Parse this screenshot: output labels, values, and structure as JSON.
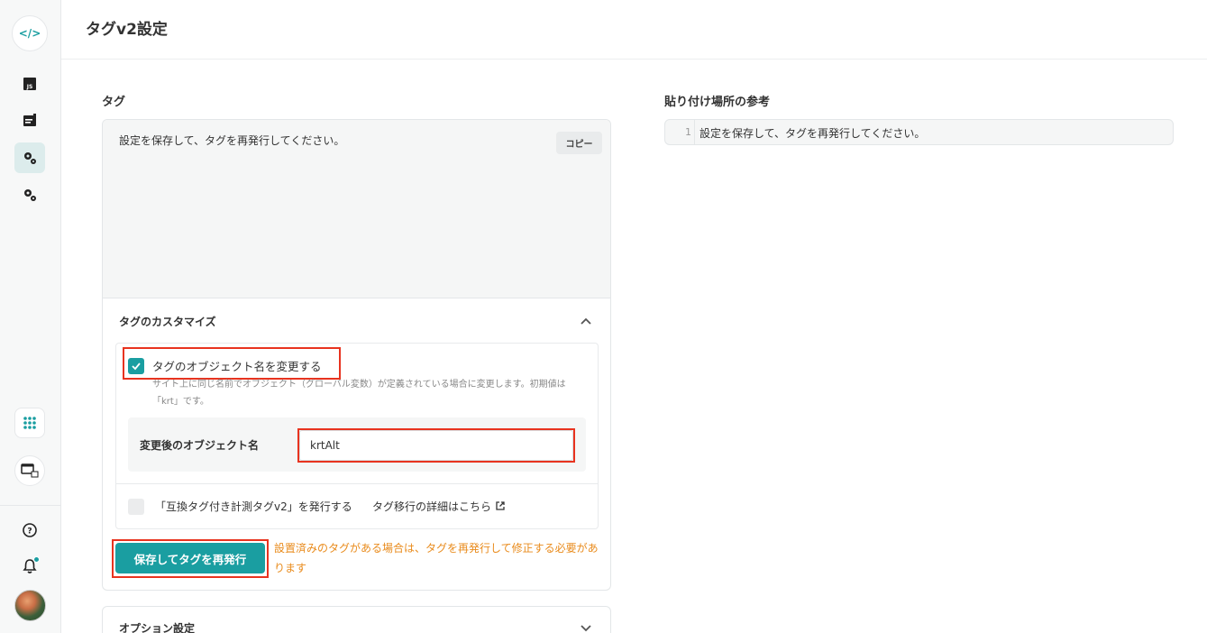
{
  "sidebar": {
    "logo_text": "</>",
    "icons": [
      "js-file-icon",
      "form-icon",
      "settings-gears-icon",
      "settings-gears-icon-2"
    ],
    "bottom_icons": [
      "apps-grid-icon",
      "window-icon",
      "help-icon",
      "bell-icon"
    ],
    "accent": "#1a9ea1"
  },
  "header": {
    "title": "タグv2設定"
  },
  "tag_section": {
    "label": "タグ",
    "code_text": "設定を保存して、タグを再発行してください。",
    "copy_label": "コピー"
  },
  "customize": {
    "title": "タグのカスタマイズ",
    "rename_checkbox": {
      "checked": true,
      "label": "タグのオブジェクト名を変更する",
      "description": "サイト上に同じ名前でオブジェクト（グローバル変数）が定義されている場合に変更します。初期値は「krt」です。"
    },
    "object_name": {
      "label": "変更後のオブジェクト名",
      "value": "krtAlt"
    },
    "compat_checkbox": {
      "checked": false,
      "label": "「互換タグ付き計測タグv2」を発行する",
      "link_text": "タグ移行の詳細はこちら"
    },
    "save_button": "保存してタグを再発行",
    "warning": "設置済みのタグがある場合は、タグを再発行して修正する必要があります"
  },
  "option_section": {
    "title": "オプション設定"
  },
  "reference": {
    "label": "貼り付け場所の参考",
    "line_number": "1",
    "line_text": "設定を保存して、タグを再発行してください。"
  }
}
